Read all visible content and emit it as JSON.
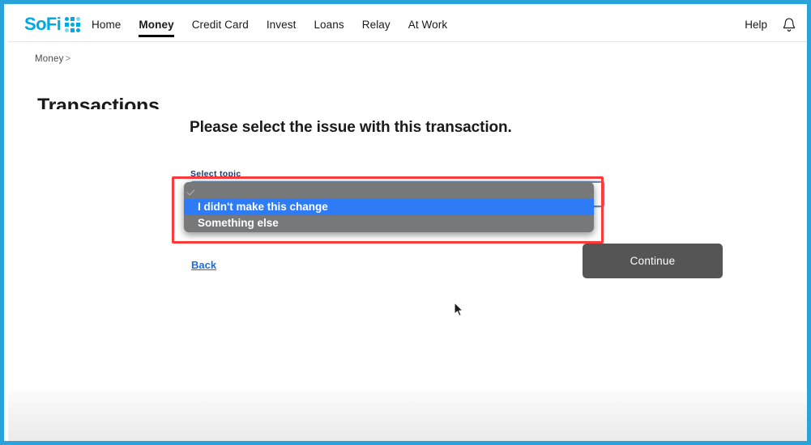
{
  "brand": {
    "logo_text": "SoFi",
    "logo_color": "#00a9e0",
    "logo_icon": "sofi-dot-grid-icon"
  },
  "header": {
    "nav_items": [
      {
        "label": "Home",
        "active": false
      },
      {
        "label": "Money",
        "active": true
      },
      {
        "label": "Credit Card",
        "active": false
      },
      {
        "label": "Invest",
        "active": false
      },
      {
        "label": "Loans",
        "active": false
      },
      {
        "label": "Relay",
        "active": false
      },
      {
        "label": "At Work",
        "active": false
      }
    ],
    "help_label": "Help",
    "bell_icon": "notification-bell-icon"
  },
  "breadcrumb": {
    "items": [
      "Money"
    ],
    "separator": ">"
  },
  "page": {
    "title": "Transactions"
  },
  "main": {
    "question": "Please select the issue with this transaction.",
    "field_label": "Select topic",
    "field_label_color": "#1b3a6b",
    "select_value": "",
    "back_label": "Back",
    "back_color": "#1f6fd0",
    "continue_label": "Continue",
    "continue_bg": "#555555"
  },
  "dropdown": {
    "open": true,
    "highlight_color": "#2f7bf6",
    "background_color": "#77787a",
    "options": [
      {
        "label": "",
        "selected": true,
        "highlighted": false
      },
      {
        "label": "I didn't make this change",
        "selected": false,
        "highlighted": true
      },
      {
        "label": "Something else",
        "selected": false,
        "highlighted": false
      }
    ]
  },
  "annotation": {
    "color": "#fb3b3b",
    "shape": "rectangle"
  },
  "frame": {
    "border_color": "#29a3da"
  }
}
